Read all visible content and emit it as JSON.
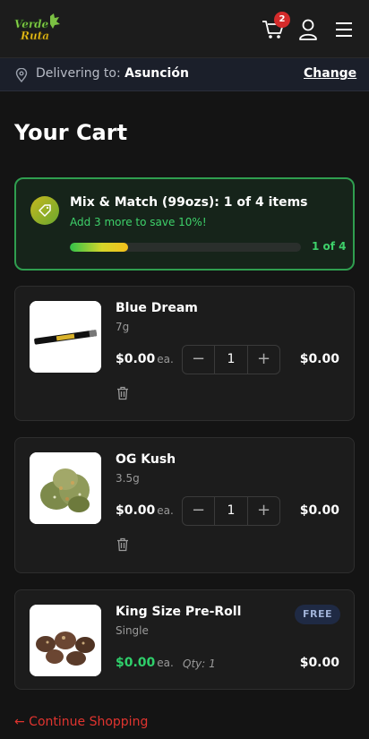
{
  "header": {
    "logo_text_line1": "Verde",
    "logo_text_line2": "Ruta",
    "cart_count": "2"
  },
  "delivery": {
    "label": "Delivering to:",
    "city": "Asunción",
    "change": "Change"
  },
  "page_title": "Your Cart",
  "promo": {
    "title": "Mix & Match (99ozs): 1 of 4 items",
    "subtitle": "Add 3 more to save 10%!",
    "progress_fraction": 0.25,
    "count": "1 of 4"
  },
  "items": [
    {
      "name": "Blue Dream",
      "size": "7g",
      "price": "$0.00",
      "price_unit": "ea.",
      "quantity": "1",
      "line_total": "$0.00",
      "icon": "pre-roll-image"
    },
    {
      "name": "OG Kush",
      "size": "3.5g",
      "price": "$0.00",
      "price_unit": "ea.",
      "quantity": "1",
      "line_total": "$0.00",
      "icon": "flower-image"
    },
    {
      "name": "King Size Pre-Roll",
      "size": "Single",
      "price": "$0.00",
      "price_unit": "ea.",
      "qty_text": "Qty: 1",
      "line_total": "$0.00",
      "badge": "FREE",
      "icon": "nuggets-image"
    }
  ],
  "qty_controls": {
    "minus": "−",
    "plus": "+"
  },
  "continue": "← Continue Shopping",
  "colors": {
    "accent_green": "#2fd06b",
    "danger_red": "#e0342f",
    "badge_red": "#d42b2b"
  }
}
